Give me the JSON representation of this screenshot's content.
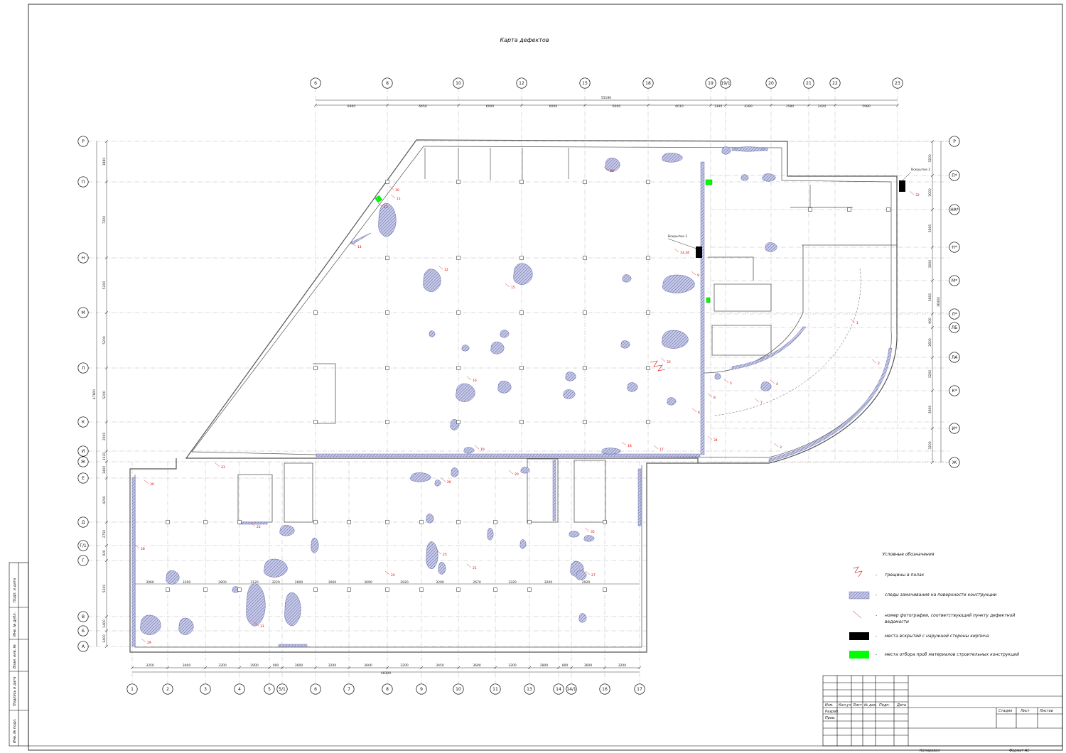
{
  "title": "Карта дефектов",
  "axes_top": [
    "6",
    "8",
    "10",
    "12",
    "15",
    "18",
    "19",
    "19/1",
    "20",
    "21",
    "22",
    "23"
  ],
  "axes_bottom": [
    "1",
    "2",
    "3",
    "4",
    "5",
    "5/1",
    "6",
    "7",
    "8",
    "9",
    "10",
    "11",
    "13",
    "14",
    "14/1",
    "16",
    "17"
  ],
  "axes_left": [
    "Р",
    "П",
    "Н",
    "М",
    "Л",
    "К",
    "И",
    "Ж",
    "Е",
    "Д",
    "Г/1",
    "Г",
    "В",
    "Б",
    "А"
  ],
  "axes_right": [
    "Р",
    "П*",
    "НА*",
    "Н*",
    "М*",
    "Л*",
    "ЛБ",
    "ЛА",
    "К*",
    "И*",
    "Ж"
  ],
  "dims_top": [
    "6800",
    "6650",
    "6000",
    "6000",
    "6000",
    "6010",
    "1390",
    "4280",
    "3580",
    "2420",
    "5980"
  ],
  "dim_top_total": "55180",
  "dims_bottom": [
    "3350",
    "3600",
    "3200",
    "2900",
    "900",
    "3600",
    "3200",
    "3600",
    "3200",
    "3450",
    "3600",
    "3200",
    "2800",
    "800",
    "3600",
    "3200"
  ],
  "dim_bottom_total": "48300",
  "dims_left": [
    "3880",
    "7200",
    "5200",
    "5200",
    "5200",
    "2900",
    "1030",
    "1400",
    "4200",
    "2750",
    "920",
    "5300",
    "1400",
    "1400"
  ],
  "dim_left_total": "47800",
  "dims_right": [
    "3200",
    "3000",
    "3600",
    "3000",
    "3600",
    "900",
    "2600",
    "3200",
    "3600",
    "3200"
  ],
  "dim_right_total": "36400",
  "row_dims": [
    "3060",
    "3200",
    "2800",
    "3120",
    "3220",
    "2600",
    "3060",
    "3090",
    "2920",
    "3200",
    "2670",
    "3220",
    "3200",
    "2920"
  ],
  "notes": [
    "1",
    "2",
    "3",
    "4",
    "5",
    "6",
    "7",
    "8",
    "9",
    "10",
    "11",
    "12",
    "13",
    "14",
    "15",
    "16",
    "17",
    "18",
    "19",
    "20",
    "21",
    "22",
    "23",
    "24",
    "25",
    "26",
    "27",
    "28",
    "29",
    "30",
    "31",
    "32",
    "33",
    "33,34",
    "34",
    "35",
    "36"
  ],
  "openings": [
    "Вскрытие 1",
    "Вскрытие 2"
  ],
  "legend": {
    "heading": "Условные обозначения",
    "dash": "-",
    "items": [
      {
        "symbol": "crack",
        "text": "трещины в полах"
      },
      {
        "symbol": "hatch",
        "text": "следы замачивания на поверхности конструкции"
      },
      {
        "symbol": "leader",
        "text": "номер фотографии, соответствующий пункту дефектной ведомости"
      },
      {
        "symbol": "black",
        "text": "места вскрытий с наружной стороны кирпича"
      },
      {
        "symbol": "green",
        "text": "места отбора проб материалов строительных конструкций"
      }
    ]
  },
  "stamp": {
    "headers": [
      "Изм.",
      "Кол.уч",
      "Лист",
      "№ док.",
      "Подп.",
      "Дата"
    ],
    "rows": [
      "Разраб.",
      "Пров."
    ],
    "stage_headers": [
      "Стадия",
      "Лист",
      "Листов"
    ],
    "copied": "Копировал",
    "format": "Формат  А1"
  },
  "side_fields": [
    "Подп. и дата",
    "Инв. № дубл.",
    "Взам. инв. №",
    "Подпись и дата",
    "Инв. № подл."
  ],
  "colors": {
    "wall": "#555555",
    "stain_fill": "#c8cbe8",
    "stain_hatch": "#5a5fa0",
    "opening": "#000000",
    "sample": "#00ff00",
    "note": "#dd0000",
    "grid": "#999999"
  }
}
